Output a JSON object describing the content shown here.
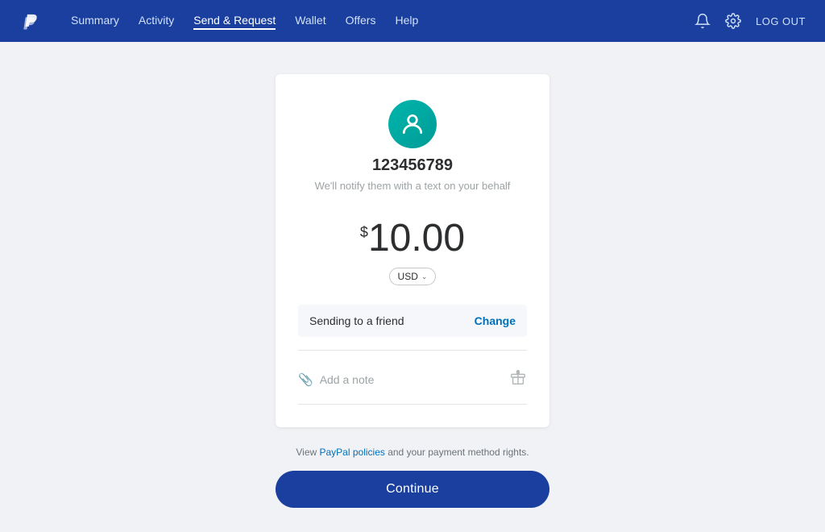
{
  "navbar": {
    "logo_alt": "PayPal",
    "links": [
      {
        "id": "summary",
        "label": "Summary",
        "active": false
      },
      {
        "id": "activity",
        "label": "Activity",
        "active": false
      },
      {
        "id": "send-request",
        "label": "Send & Request",
        "active": true
      },
      {
        "id": "wallet",
        "label": "Wallet",
        "active": false
      },
      {
        "id": "offers",
        "label": "Offers",
        "active": false
      },
      {
        "id": "help",
        "label": "Help",
        "active": false
      }
    ],
    "logout_label": "LOG OUT"
  },
  "card": {
    "recipient_name": "123456789",
    "notify_text": "We'll notify them with a text on your behalf",
    "currency_symbol": "$",
    "amount": "10.00",
    "currency": "USD",
    "sending_label": "Sending to a friend",
    "change_label": "Change",
    "note_placeholder": "Add a note"
  },
  "footer": {
    "policy_prefix": "View ",
    "policy_link_text": "PayPal policies",
    "policy_suffix": " and your payment method rights.",
    "continue_label": "Continue"
  }
}
